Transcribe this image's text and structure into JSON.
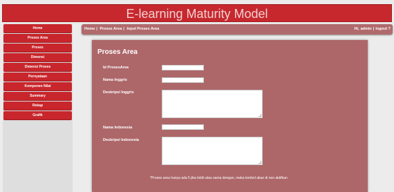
{
  "header": {
    "title": "E-learning Maturity Model"
  },
  "sidebar": {
    "items": [
      {
        "label": "Home"
      },
      {
        "label": "Proses Area"
      },
      {
        "label": "Proses"
      },
      {
        "label": "Dimensi"
      },
      {
        "label": "Dimensi Proses"
      },
      {
        "label": "Pernyataan"
      },
      {
        "label": "Komponen Nilai"
      },
      {
        "label": "Summary"
      },
      {
        "label": "Rekap"
      },
      {
        "label": "Grafik"
      }
    ]
  },
  "breadcrumb": {
    "items": [
      "Home",
      "Proses Area",
      "Input Proses Area"
    ],
    "separator": "|",
    "greeting": "Hi,",
    "username": "admin",
    "logout": "logout ?"
  },
  "form": {
    "title": "Proses Area",
    "fields": {
      "id": {
        "label": "Id ProsesArea",
        "value": ""
      },
      "name_en": {
        "label": "Nama Inggris",
        "value": ""
      },
      "desc_en": {
        "label": "Deskripsi Inggris",
        "value": ""
      },
      "name_id": {
        "label": "Nama Indonesia",
        "value": ""
      },
      "desc_id": {
        "label": "Deskripsi Indonesia",
        "value": ""
      }
    },
    "note": "*Proses area hanya ada 5 jika lebih atau sama dengan, maka tombol akan di non aktifkan"
  },
  "colors": {
    "header_bg": "#c6282e",
    "menu_bg": "#c8262c",
    "panel_bg": "#ad6769",
    "breadcrumb_bg": "#b06a6c",
    "page_bg": "#ececec"
  }
}
